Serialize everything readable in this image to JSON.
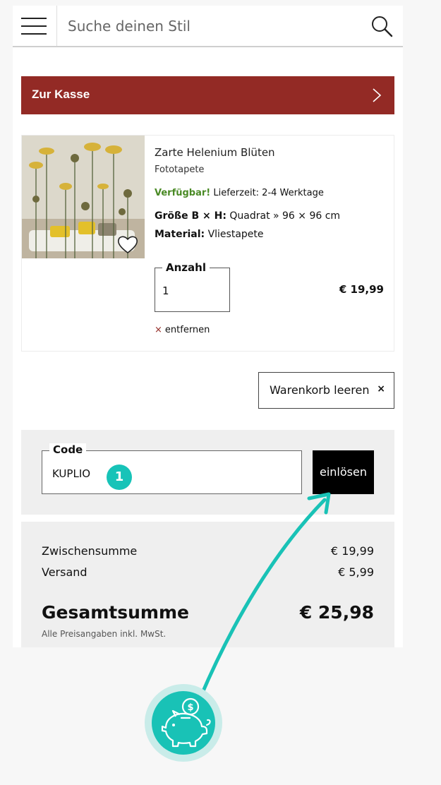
{
  "header": {
    "search_placeholder": "Suche deinen Stil",
    "menu_icon": "hamburger-icon",
    "search_icon": "magnifier-icon"
  },
  "checkout": {
    "label": "Zur Kasse",
    "icon": "chevron-right-icon"
  },
  "product": {
    "title": "Zarte Helenium Blüten",
    "type": "Fototapete",
    "availability": "Verfügbar!",
    "delivery": "Lieferzeit: 2-4 Werktage",
    "size_label": "Größe B × H:",
    "size_value": "Quadrat » 96 × 96 cm",
    "material_label": "Material:",
    "material_value": "Vliestapete",
    "quantity_label": "Anzahl",
    "quantity_value": "1",
    "price": "€ 19,99",
    "remove_label": "entfernen",
    "remove_icon": "×"
  },
  "cart": {
    "clear_label": "Warenkorb leeren",
    "clear_icon": "×"
  },
  "coupon": {
    "label": "Code",
    "value": "KUPLIO",
    "step": "1",
    "redeem_label": "einlösen"
  },
  "summary": {
    "subtotal_label": "Zwischensumme",
    "subtotal_value": "€ 19,99",
    "shipping_label": "Versand",
    "shipping_value": "€ 5,99",
    "total_label": "Gesamtsumme",
    "total_value": "€ 25,98",
    "vat_note": "Alle Preisangaben inkl. MwSt."
  },
  "colors": {
    "brand_red": "#932a25",
    "accent_teal": "#19c2b6",
    "available_green": "#4a8a25"
  },
  "overlay": {
    "icon": "piggy-bank-coin-icon"
  }
}
